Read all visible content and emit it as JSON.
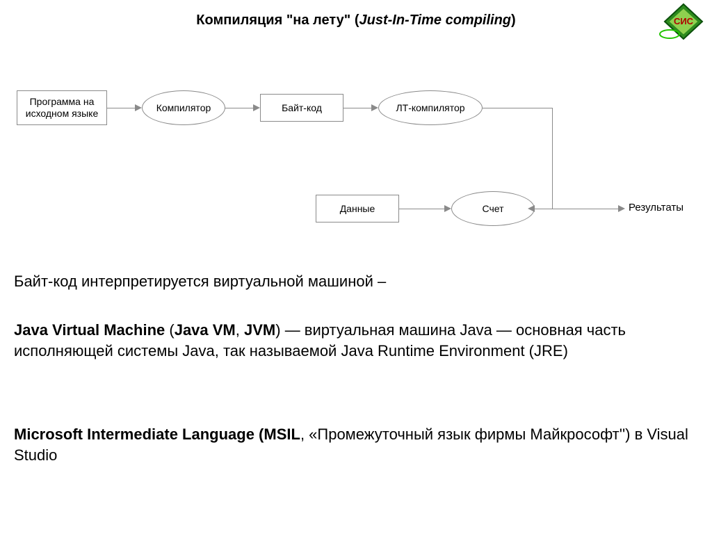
{
  "title": {
    "prefix": "Компиляция \"на лету\" (",
    "italic": "Just-In-Time compiling",
    "suffix": ")"
  },
  "logo": {
    "text": "СИС"
  },
  "nodes": {
    "source": "Программа на исходном языке",
    "compiler": "Компилятор",
    "bytecode": "Байт-код",
    "jit": "ЛТ-компилятор",
    "data": "Данные",
    "run": "Счет",
    "results": "Результаты"
  },
  "text": {
    "p1": "Байт-код интерпретируется виртуальной машиной –",
    "p2_bold": "Java Virtual Machine",
    "p2_rest1": " (",
    "p2_bold2": "Java VM",
    "p2_rest2": ", ",
    "p2_bold3": "JVM",
    "p2_rest3": ") — виртуальная машина Java — основная часть исполняющей системы Java, так называемой Java Runtime Environment (JRE)",
    "p3_bold": "Microsoft Intermediate Language (MSIL",
    "p3_rest": ", «Промежуточный язык фирмы Майкрософт'') в Visual Studio"
  }
}
